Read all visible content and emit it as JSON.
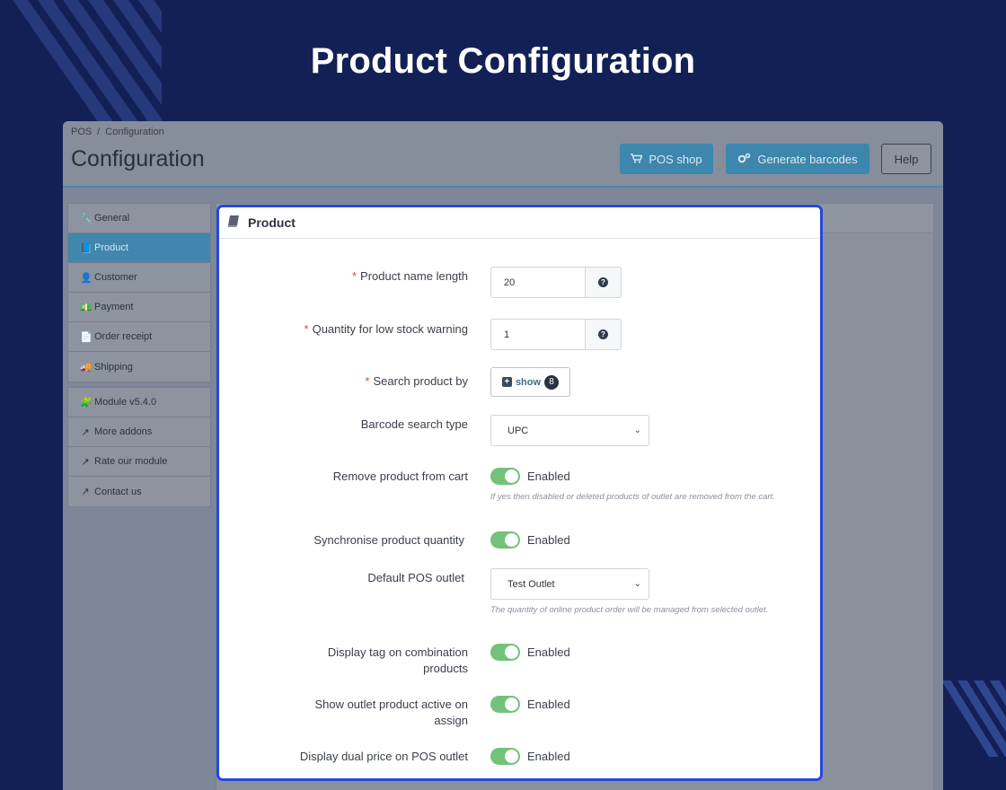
{
  "hero": {
    "title": "Product Configuration"
  },
  "header": {
    "breadcrumb_root": "POS",
    "breadcrumb_sep": "/",
    "breadcrumb_current": "Configuration",
    "title": "Configuration",
    "buttons": {
      "pos_shop": "POS shop",
      "generate_barcodes": "Generate barcodes",
      "help": "Help"
    }
  },
  "sidebar": {
    "group1": [
      {
        "label": "General",
        "icon": "wrench-icon"
      },
      {
        "label": "Product",
        "icon": "book-icon",
        "active": true
      },
      {
        "label": "Customer",
        "icon": "user-icon"
      },
      {
        "label": "Payment",
        "icon": "money-icon"
      },
      {
        "label": "Order receipt",
        "icon": "file-icon"
      },
      {
        "label": "Shipping",
        "icon": "truck-icon"
      }
    ],
    "group2": [
      {
        "label": "Module v5.4.0",
        "icon": "puzzle-icon"
      },
      {
        "label": "More addons",
        "icon": "external-link-icon"
      },
      {
        "label": "Rate our module",
        "icon": "external-link-icon"
      },
      {
        "label": "Contact us",
        "icon": "external-link-icon"
      }
    ]
  },
  "panel": {
    "title": "Product",
    "fields": {
      "name_length": {
        "label": "Product name length",
        "value": "20"
      },
      "low_stock": {
        "label": "Quantity for low stock warning",
        "value": "1"
      },
      "search_by": {
        "label": "Search product by",
        "button": "show",
        "count": "8"
      },
      "barcode_type": {
        "label": "Barcode search type",
        "selected": "UPC"
      },
      "remove_cart": {
        "label": "Remove product from cart",
        "state": "Enabled",
        "help": "If yes then disabled or deleted products of outlet are removed from the cart."
      },
      "sync_qty": {
        "label": "Synchronise product quantity",
        "state": "Enabled"
      },
      "default_outlet": {
        "label": "Default POS outlet",
        "selected": "Test Outlet",
        "help": "The quantity of online product order will be managed from selected outlet."
      },
      "display_tag": {
        "label": "Display tag on combination products",
        "state": "Enabled"
      },
      "outlet_active": {
        "label": "Show outlet product active on assign",
        "state": "Enabled"
      },
      "dual_price": {
        "label": "Display dual price on POS outlet",
        "state": "Enabled"
      }
    },
    "required_mark": "*"
  },
  "colors": {
    "background": "#132056",
    "accent_border": "#2747e0",
    "toggle_on": "#72c279",
    "primary_button": "#3d86ad"
  }
}
